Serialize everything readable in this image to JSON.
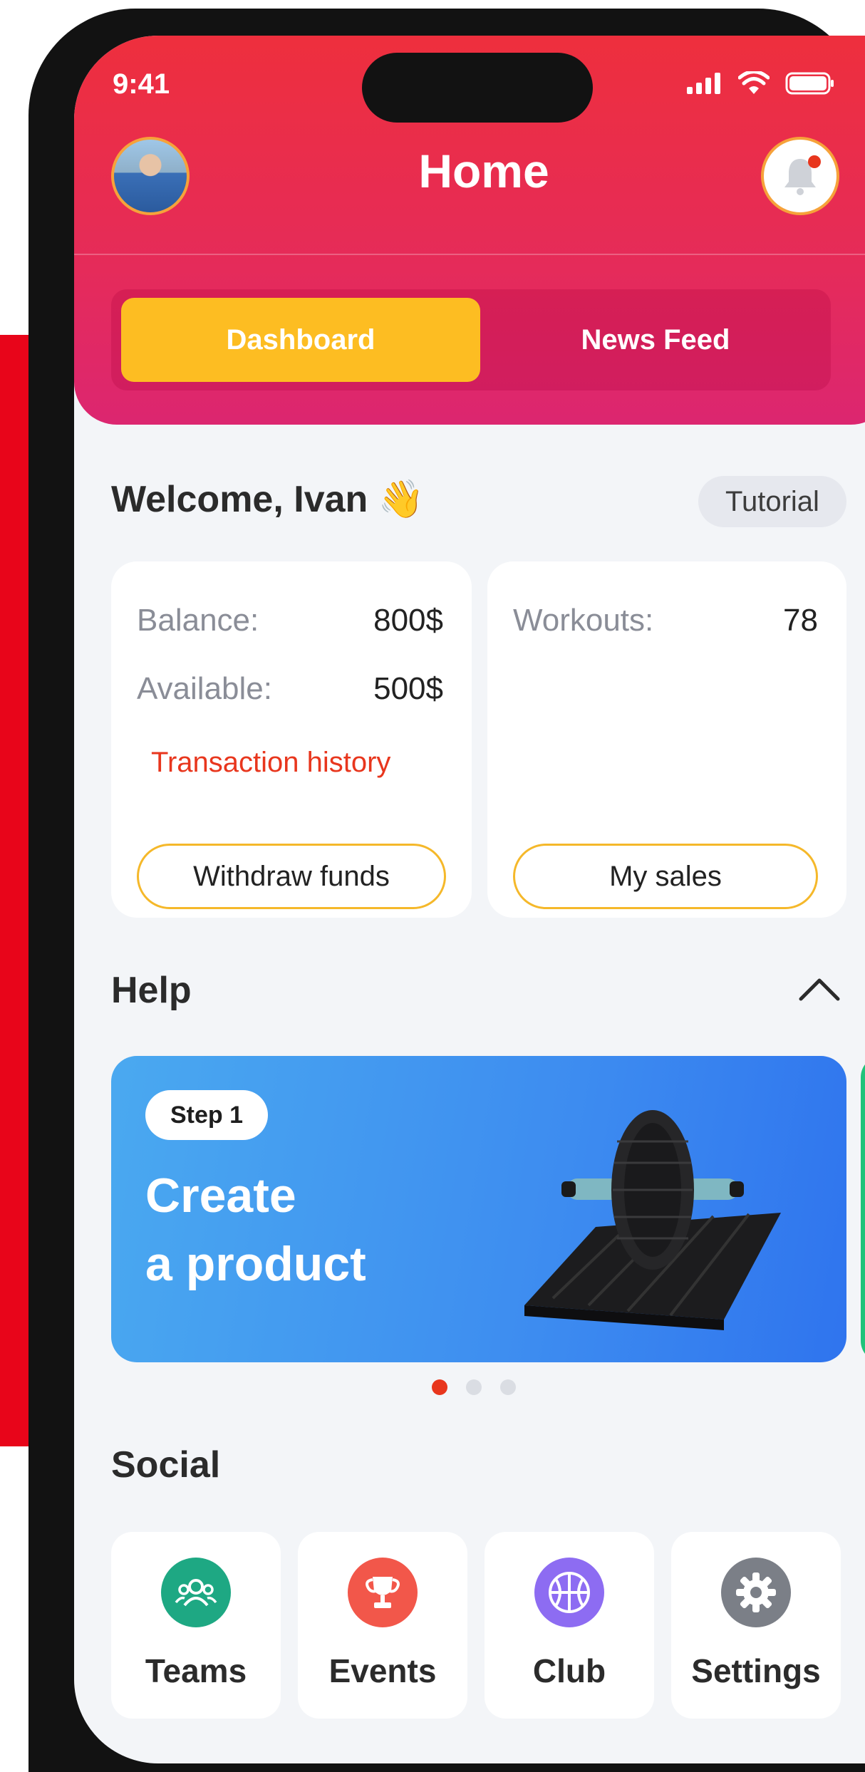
{
  "status_bar": {
    "time": "9:41"
  },
  "header": {
    "title": "Home",
    "notification_badge": true
  },
  "tabs": [
    {
      "label": "Dashboard",
      "active": true
    },
    {
      "label": "News Feed",
      "active": false
    }
  ],
  "welcome": {
    "text": "Welcome, Ivan",
    "emoji": "👋",
    "tutorial_label": "Tutorial"
  },
  "balance_card": {
    "balance_label": "Balance:",
    "balance_value": "800$",
    "available_label": "Available:",
    "available_value": "500$",
    "history_link": "Transaction history",
    "withdraw_label": "Withdraw funds"
  },
  "workouts_card": {
    "workouts_label": "Workouts:",
    "workouts_value": "78",
    "sales_label": "My sales"
  },
  "help": {
    "title": "Help",
    "banner": {
      "step": "Step 1",
      "title_line1": "Create",
      "title_line2": "a product"
    },
    "carousel_pages": 3,
    "carousel_active": 1
  },
  "social": {
    "title": "Social",
    "tiles": [
      {
        "label": "Teams",
        "icon": "people-icon",
        "color": "#1ea883"
      },
      {
        "label": "Events",
        "icon": "trophy-icon",
        "color": "#f2574a"
      },
      {
        "label": "Club",
        "icon": "basketball-icon",
        "color": "#8d6cf2"
      },
      {
        "label": "Settings",
        "icon": "gear-icon",
        "color": "#7b7f87"
      }
    ]
  },
  "colors": {
    "header_red": "#ee2f3d",
    "header_pink": "#dc2670",
    "accent_yellow": "#fdbd22",
    "link_red": "#e8361d",
    "banner_blue": "#3d8cf0"
  }
}
